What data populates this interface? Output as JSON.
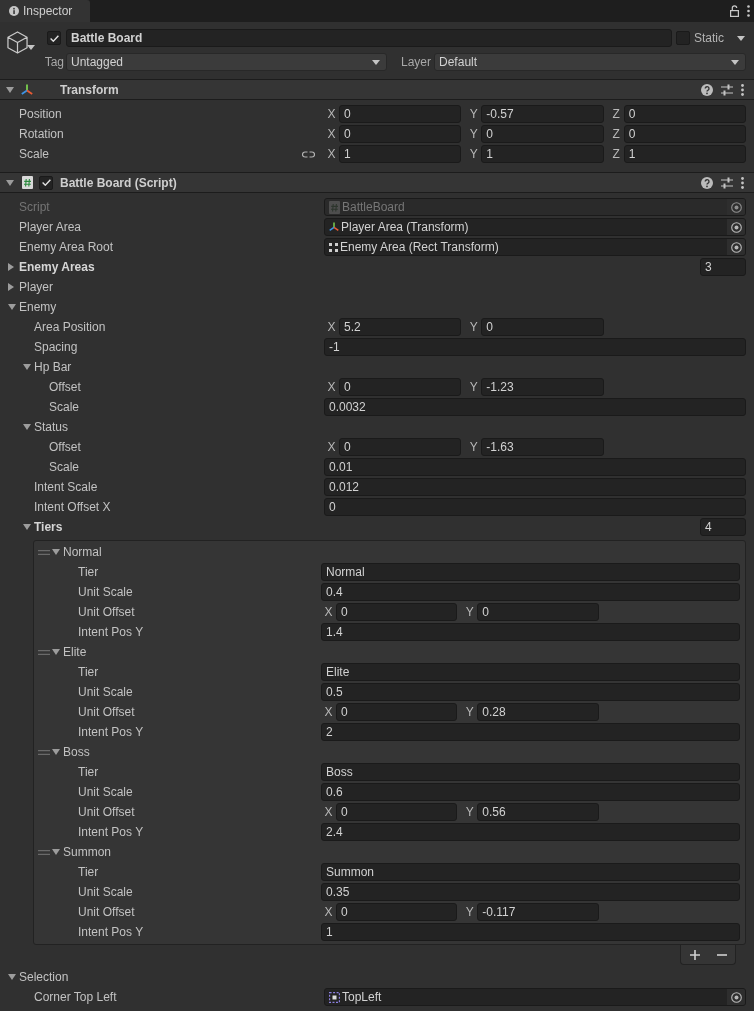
{
  "window": {
    "tab": "Inspector"
  },
  "game_object": {
    "active": true,
    "name": "Battle Board",
    "static": false,
    "static_label": "Static",
    "tag_label": "Tag",
    "tag": "Untagged",
    "layer_label": "Layer",
    "layer": "Default"
  },
  "components": [
    {
      "kind": "transform",
      "title": "Transform",
      "expanded": true,
      "rows": [
        {
          "kind": "vector",
          "label": "Position",
          "fields": [
            {
              "axis": "X",
              "value": "0"
            },
            {
              "axis": "Y",
              "value": "-0.57"
            },
            {
              "axis": "Z",
              "value": "0"
            }
          ]
        },
        {
          "kind": "vector",
          "label": "Rotation",
          "fields": [
            {
              "axis": "X",
              "value": "0"
            },
            {
              "axis": "Y",
              "value": "0"
            },
            {
              "axis": "Z",
              "value": "0"
            }
          ]
        },
        {
          "kind": "vector",
          "label": "Scale",
          "linked": false,
          "fields": [
            {
              "axis": "X",
              "value": "1"
            },
            {
              "axis": "Y",
              "value": "1"
            },
            {
              "axis": "Z",
              "value": "1"
            }
          ]
        }
      ]
    },
    {
      "kind": "script",
      "title": "Battle Board (Script)",
      "enabled": true,
      "expanded": true,
      "rows": [
        {
          "kind": "script",
          "label": "Script",
          "value": "BattleBoard",
          "disabled": true,
          "modified": false
        },
        {
          "kind": "transform",
          "label": "Player Area",
          "value": "Player Area (Transform)",
          "disabled": false,
          "modified": false
        },
        {
          "kind": "rect",
          "label": "Enemy Area Root",
          "value": "Enemy Area (Rect Transform)",
          "disabled": false,
          "modified": false
        },
        {
          "kind": "array",
          "label": "Enemy Areas",
          "size": "3",
          "expanded": false,
          "modified": true
        },
        {
          "kind": "foldout",
          "label": "Player",
          "expanded": false,
          "modified": false
        },
        {
          "kind": "foldout",
          "label": "Enemy",
          "expanded": true,
          "modified": false,
          "children": [
            {
              "kind": "vector",
              "label": "Area Position",
              "modified": false,
              "fields": [
                {
                  "axis": "X",
                  "value": "5.2"
                },
                {
                  "axis": "Y",
                  "value": "0"
                }
              ]
            },
            {
              "kind": "number",
              "label": "Spacing",
              "value": "-1",
              "modified": false
            },
            {
              "kind": "foldout",
              "label": "Hp Bar",
              "expanded": true,
              "modified": false,
              "children": [
                {
                  "kind": "vector",
                  "label": "Offset",
                  "fields": [
                    {
                      "axis": "X",
                      "value": "0"
                    },
                    {
                      "axis": "Y",
                      "value": "-1.23"
                    }
                  ]
                },
                {
                  "kind": "number",
                  "label": "Scale",
                  "value": "0.0032"
                }
              ]
            },
            {
              "kind": "foldout",
              "label": "Status",
              "expanded": true,
              "modified": false,
              "children": [
                {
                  "kind": "vector",
                  "label": "Offset",
                  "fields": [
                    {
                      "axis": "X",
                      "value": "0"
                    },
                    {
                      "axis": "Y",
                      "value": "-1.63"
                    }
                  ]
                },
                {
                  "kind": "number",
                  "label": "Scale",
                  "value": "0.01"
                }
              ]
            },
            {
              "kind": "number",
              "label": "Intent Scale",
              "value": "0.012",
              "modified": false
            },
            {
              "kind": "number",
              "label": "Intent Offset X",
              "value": "0",
              "modified": false
            },
            {
              "kind": "array",
              "label": "Tiers",
              "size": "4",
              "expanded": true,
              "modified": true,
              "elements": [
                {
                  "title": "Normal",
                  "expanded": true,
                  "rows": [
                    {
                      "kind": "text",
                      "label": "Tier",
                      "value": "Normal"
                    },
                    {
                      "kind": "number",
                      "label": "Unit Scale",
                      "value": "0.4"
                    },
                    {
                      "kind": "vector",
                      "label": "Unit Offset",
                      "fields": [
                        {
                          "axis": "X",
                          "value": "0"
                        },
                        {
                          "axis": "Y",
                          "value": "0"
                        }
                      ]
                    },
                    {
                      "kind": "number",
                      "label": "Intent Pos Y",
                      "value": "1.4"
                    }
                  ]
                },
                {
                  "title": "Elite",
                  "expanded": true,
                  "rows": [
                    {
                      "kind": "text",
                      "label": "Tier",
                      "value": "Elite"
                    },
                    {
                      "kind": "number",
                      "label": "Unit Scale",
                      "value": "0.5"
                    },
                    {
                      "kind": "vector",
                      "label": "Unit Offset",
                      "fields": [
                        {
                          "axis": "X",
                          "value": "0"
                        },
                        {
                          "axis": "Y",
                          "value": "0.28"
                        }
                      ]
                    },
                    {
                      "kind": "number",
                      "label": "Intent Pos Y",
                      "value": "2"
                    }
                  ]
                },
                {
                  "title": "Boss",
                  "expanded": true,
                  "rows": [
                    {
                      "kind": "text",
                      "label": "Tier",
                      "value": "Boss"
                    },
                    {
                      "kind": "number",
                      "label": "Unit Scale",
                      "value": "0.6"
                    },
                    {
                      "kind": "vector",
                      "label": "Unit Offset",
                      "fields": [
                        {
                          "axis": "X",
                          "value": "0"
                        },
                        {
                          "axis": "Y",
                          "value": "0.56"
                        }
                      ]
                    },
                    {
                      "kind": "number",
                      "label": "Intent Pos Y",
                      "value": "2.4"
                    }
                  ]
                },
                {
                  "title": "Summon",
                  "expanded": true,
                  "rows": [
                    {
                      "kind": "text",
                      "label": "Tier",
                      "value": "Summon"
                    },
                    {
                      "kind": "number",
                      "label": "Unit Scale",
                      "value": "0.35"
                    },
                    {
                      "kind": "vector",
                      "label": "Unit Offset",
                      "fields": [
                        {
                          "axis": "X",
                          "value": "0"
                        },
                        {
                          "axis": "Y",
                          "value": "-0.117"
                        }
                      ]
                    },
                    {
                      "kind": "number",
                      "label": "Intent Pos Y",
                      "value": "1"
                    }
                  ]
                }
              ]
            }
          ]
        },
        {
          "kind": "foldout",
          "label": "Selection",
          "expanded": true,
          "modified": false,
          "children": [
            {
              "kind": "anchor",
              "label": "Corner Top Left",
              "value": "TopLeft",
              "disabled": false
            }
          ]
        }
      ]
    }
  ]
}
